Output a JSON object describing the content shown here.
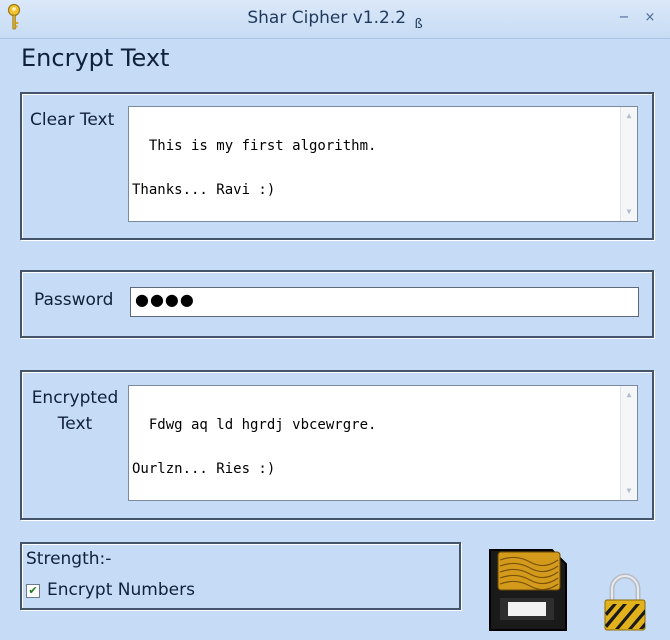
{
  "window": {
    "title": "Shar Cipher v1.2.2",
    "beta_mark": "ß",
    "minimize_glyph": "−",
    "close_glyph": "×"
  },
  "heading": "Encrypt Text",
  "clear_text": {
    "label": "Clear Text",
    "value": "This is my first algorithm.\n\nThanks... Ravi :)"
  },
  "password": {
    "label": "Password",
    "value": "●●●●"
  },
  "encrypted_text": {
    "label_line1": "Encrypted",
    "label_line2": "Text",
    "value": "Fdwg aq ld hgrdj vbcewrgre.\n\nOurlzn... Ries :)"
  },
  "options": {
    "strength_label": "Strength:-",
    "encrypt_numbers_label": "Encrypt Numbers",
    "encrypt_numbers_checked": true,
    "check_glyph": "✔"
  },
  "scroll": {
    "up_glyph": "▲",
    "down_glyph": "▼"
  },
  "icons": {
    "app": "key-icon",
    "encrypt_action": "memory-card-icon",
    "lock": "padlock-icon"
  }
}
